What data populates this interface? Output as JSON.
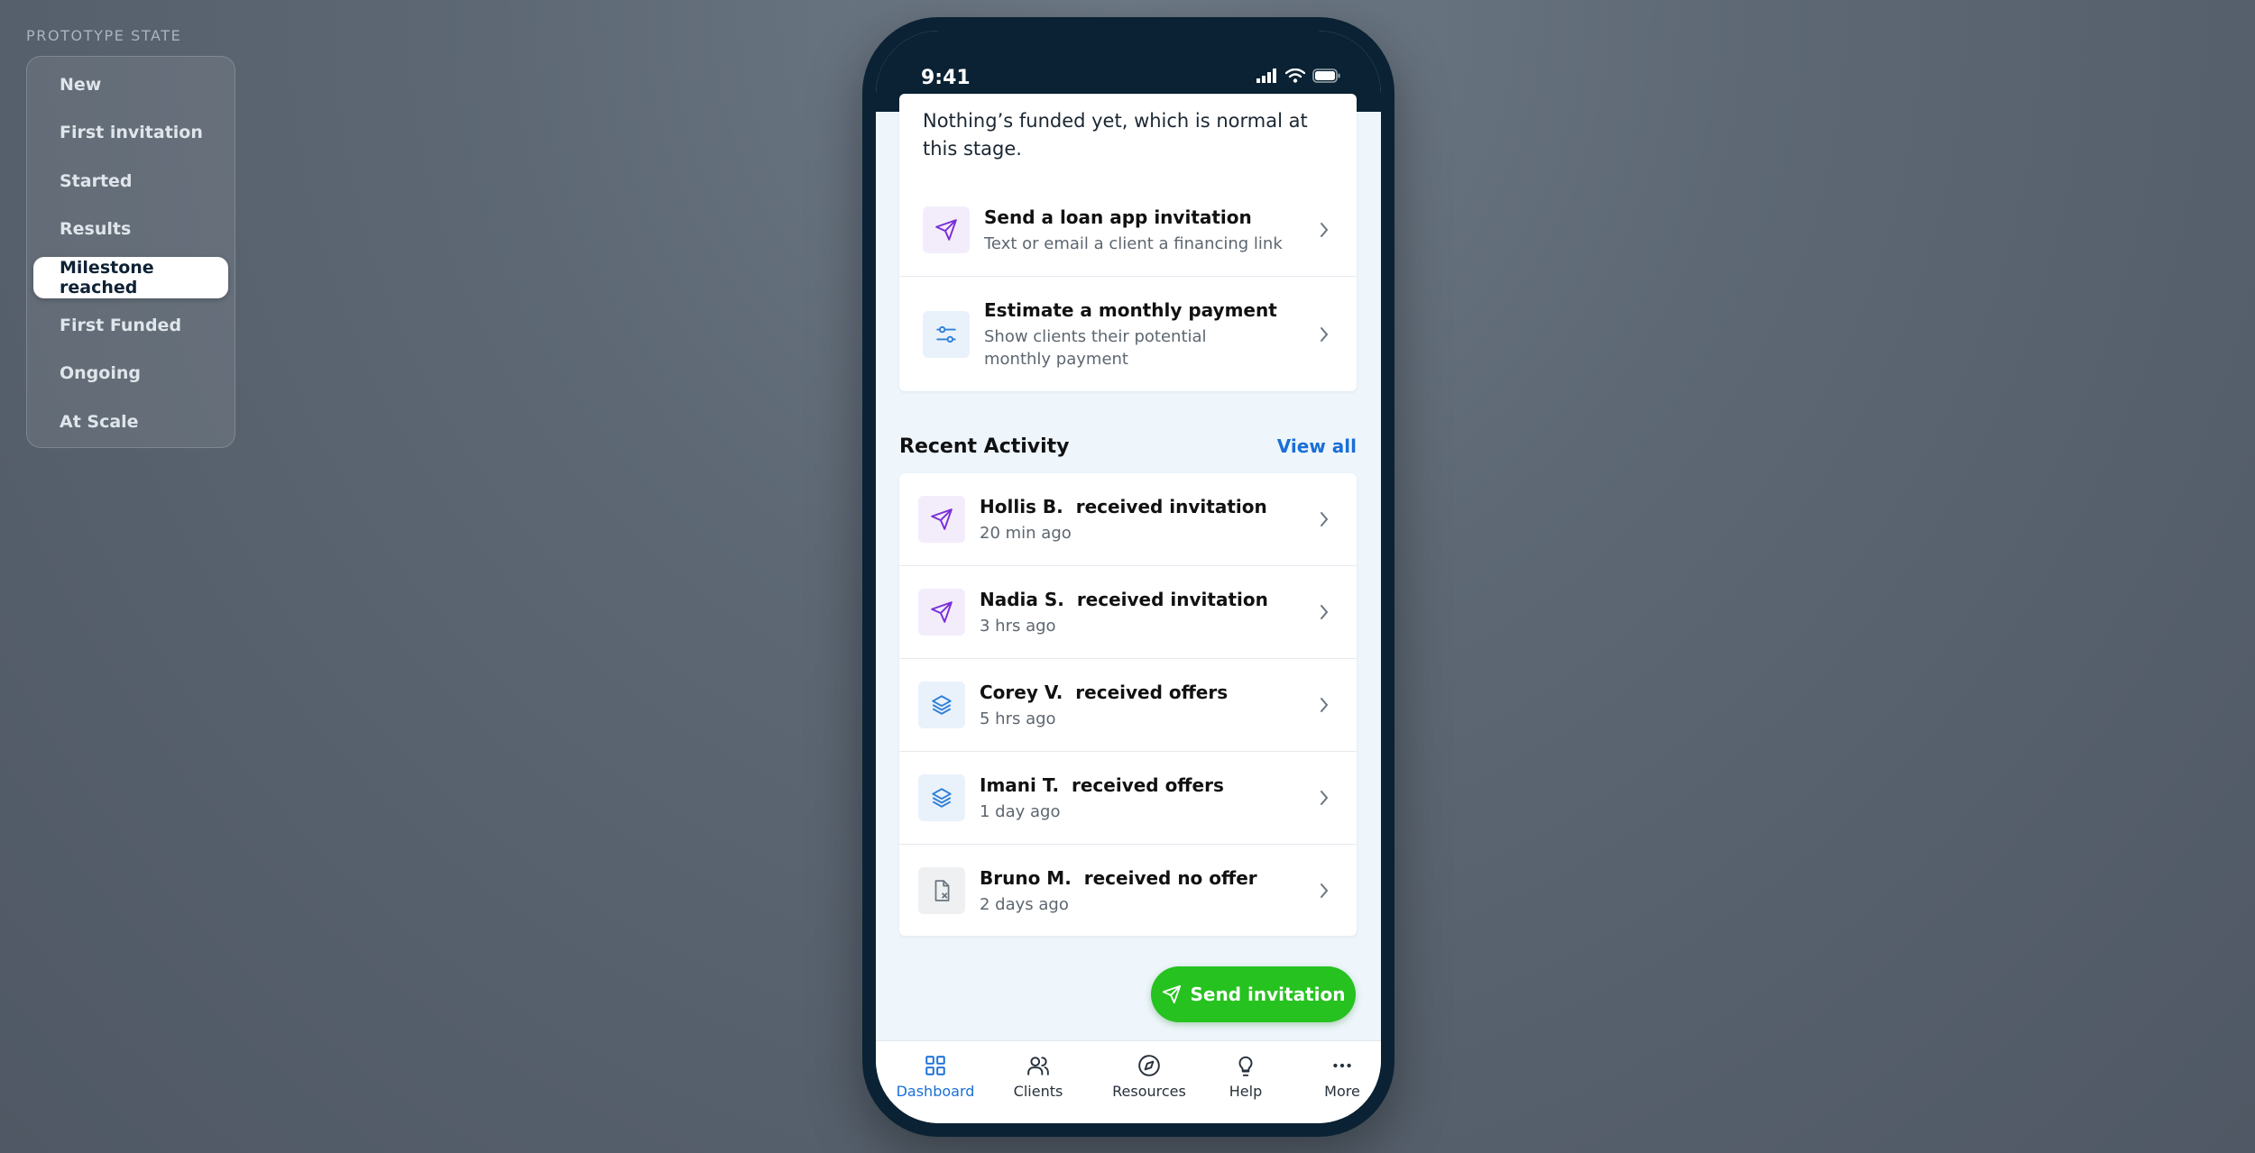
{
  "prototype": {
    "label": "PROTOTYPE STATE",
    "items": [
      {
        "label": "New"
      },
      {
        "label": "First invitation"
      },
      {
        "label": "Started"
      },
      {
        "label": "Results"
      },
      {
        "label": "Milestone reached"
      },
      {
        "label": "First Funded"
      },
      {
        "label": "Ongoing"
      },
      {
        "label": "At Scale"
      }
    ],
    "active_index": 4
  },
  "status_bar": {
    "time": "9:41"
  },
  "funding_card": {
    "text": "Nothing’s funded yet, which is normal at this stage.",
    "actions": [
      {
        "title": "Send a loan app invitation",
        "subtitle": "Text or email a client a financing link",
        "icon": "send-icon"
      },
      {
        "title": "Estimate a monthly payment",
        "subtitle": "Show clients their potential monthly payment",
        "icon": "sliders-icon"
      }
    ]
  },
  "recent_activity": {
    "title": "Recent Activity",
    "view_all": "View all",
    "items": [
      {
        "name": "Hollis B.",
        "event": "received invitation",
        "time": "20 min ago",
        "icon": "send-icon"
      },
      {
        "name": "Nadia S.",
        "event": "received invitation",
        "time": "3 hrs ago",
        "icon": "send-icon"
      },
      {
        "name": "Corey V.",
        "event": "received offers",
        "time": "5 hrs ago",
        "icon": "layers-icon"
      },
      {
        "name": "Imani T.",
        "event": "received offers",
        "time": "1 day ago",
        "icon": "layers-icon"
      },
      {
        "name": "Bruno M.",
        "event": "received no offer",
        "time": "2 days ago",
        "icon": "file-x-icon"
      }
    ]
  },
  "fab": {
    "label": "Send invitation"
  },
  "tabbar": {
    "tabs": [
      {
        "label": "Dashboard",
        "icon": "grid-icon"
      },
      {
        "label": "Clients",
        "icon": "users-icon"
      },
      {
        "label": "Resources",
        "icon": "compass-icon"
      },
      {
        "label": "Help",
        "icon": "lightbulb-icon"
      },
      {
        "label": "More",
        "icon": "more-icon"
      }
    ],
    "active_index": 0
  },
  "colors": {
    "accent": "#1a6fd6",
    "cta": "#26c21f",
    "invite_icon": "#7a2fd8",
    "offer_icon": "#2f7fd6",
    "phone_frame": "#0a2233"
  }
}
